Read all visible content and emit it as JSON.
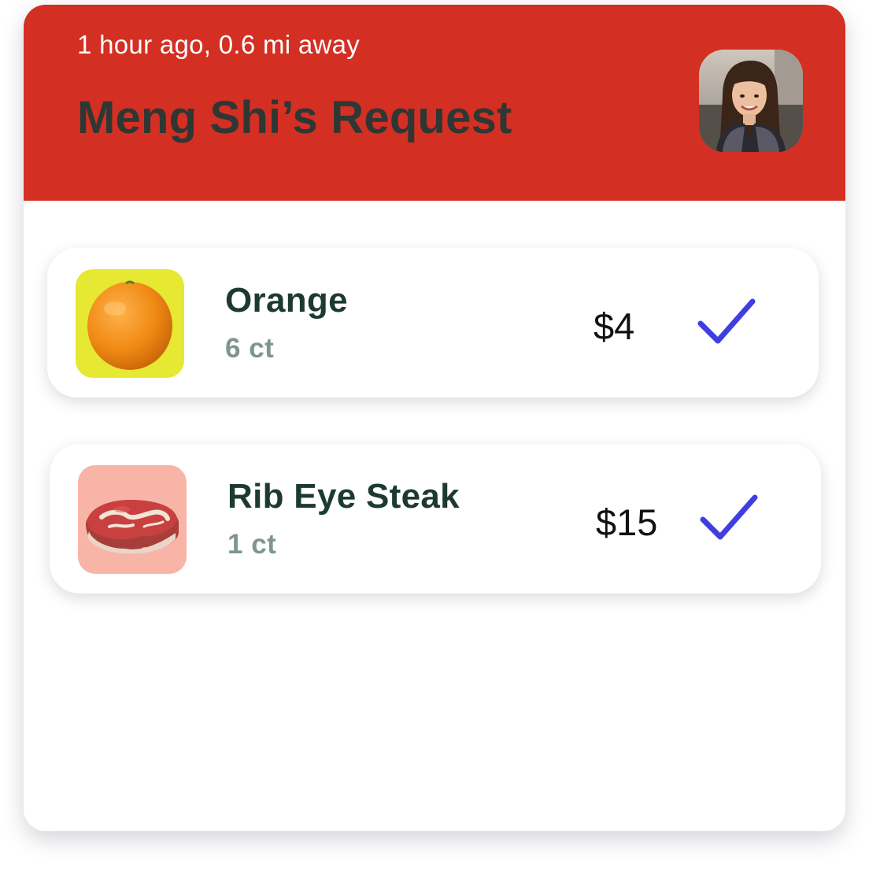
{
  "colors": {
    "header_bg": "#d42f23",
    "title_text": "#2f3734",
    "item_name": "#1d3a32",
    "item_qty": "#7f9690",
    "check": "#3f3fe0",
    "orange_thumb_bg": "#e6e832",
    "steak_thumb_bg": "#f9b4a8"
  },
  "request": {
    "meta": "1 hour ago, 0.6 mi away",
    "title": "Meng Shi’s Request",
    "avatar_icon": "user-photo-avatar"
  },
  "items": [
    {
      "name": "Orange",
      "quantity": "6 ct",
      "price": "$4",
      "checked": true,
      "image_icon": "orange-fruit-image"
    },
    {
      "name": "Rib Eye Steak",
      "quantity": "1 ct",
      "price": "$15",
      "checked": true,
      "image_icon": "steak-image"
    }
  ]
}
